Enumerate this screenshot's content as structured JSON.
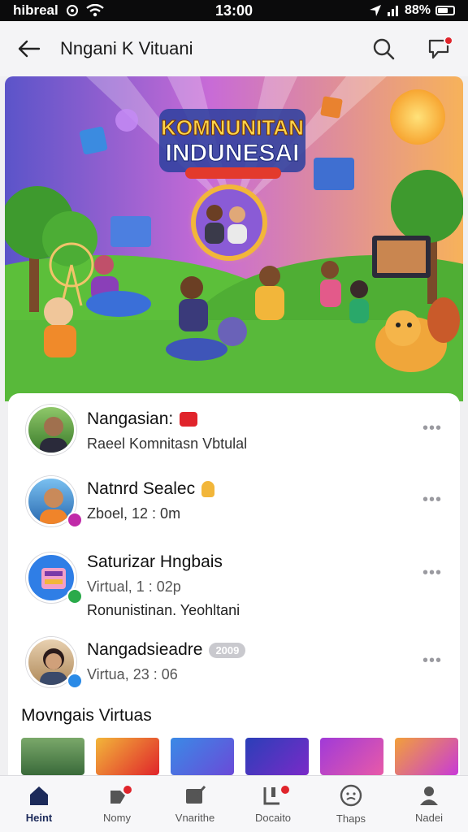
{
  "status_bar": {
    "carrier": "hibreal",
    "time": "13:00",
    "battery": "88%"
  },
  "header": {
    "title": "Nngani K Vituani"
  },
  "banner": {
    "headline_line1": "KOMNUNITAN",
    "headline_line2": "INDUNESAI"
  },
  "items": [
    {
      "name": "Nangasian:",
      "line1": "Raeel Komnitasn Vbtulal",
      "line2": ""
    },
    {
      "name": "Natnrd Sealec",
      "line1": "Zboel, 12 : 0m",
      "line2": ""
    },
    {
      "name": "Saturizar Hngbais",
      "line1": "Virtual, 1 : 02p",
      "line2": "Ronunistinan. Yeohltani"
    },
    {
      "name": "Nangadsieadre",
      "badge": "2009",
      "line1": "Virtua, 23 : 06",
      "line2": ""
    }
  ],
  "section": {
    "title": "Movngais Virtuas"
  },
  "tabs": [
    {
      "label": "Heint",
      "icon": "home-icon"
    },
    {
      "label": "Nomy",
      "icon": "notification-icon"
    },
    {
      "label": "Vnarithe",
      "icon": "edit-icon"
    },
    {
      "label": "Docaito",
      "icon": "doc-icon"
    },
    {
      "label": "Thaps",
      "icon": "face-icon"
    },
    {
      "label": "Nadei",
      "icon": "profile-icon"
    }
  ],
  "colors": {
    "accent": "#1c2a5a",
    "notify": "#e0242b"
  }
}
